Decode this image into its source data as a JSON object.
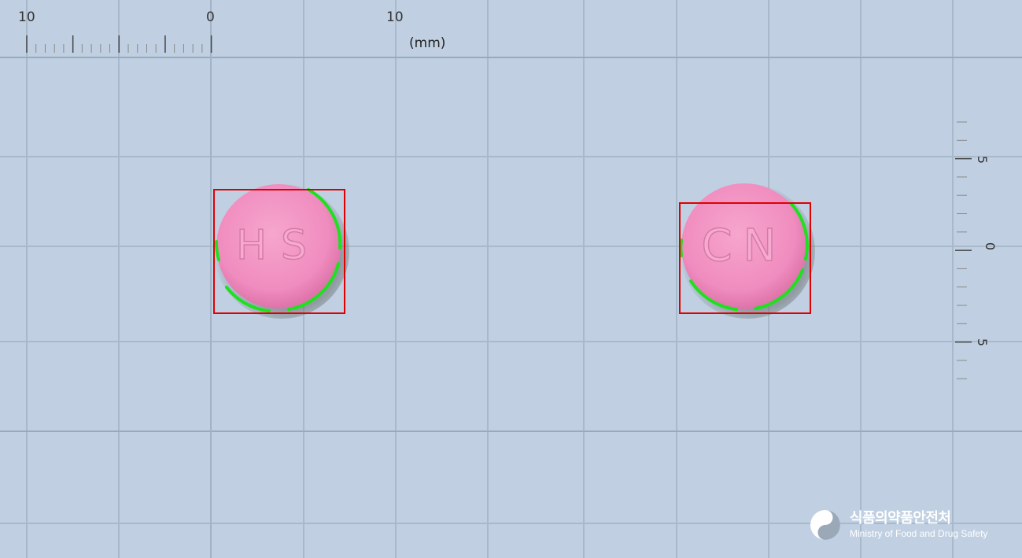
{
  "ruler": {
    "horizontal_labels": [
      "10",
      "0",
      "10"
    ],
    "unit": "(mm)",
    "vertical_labels": [
      "5",
      "0",
      "5"
    ]
  },
  "pills": [
    {
      "imprint": "HS",
      "color": "#f08cbf",
      "shape": "round"
    },
    {
      "imprint": "CN",
      "color": "#f08cbf",
      "shape": "round"
    }
  ],
  "detection": {
    "box_color": "#e00000",
    "contour_color": "#1fe01f"
  },
  "logo": {
    "korean": "식품의약품안전처",
    "english": "Ministry of Food and Drug Safety"
  }
}
